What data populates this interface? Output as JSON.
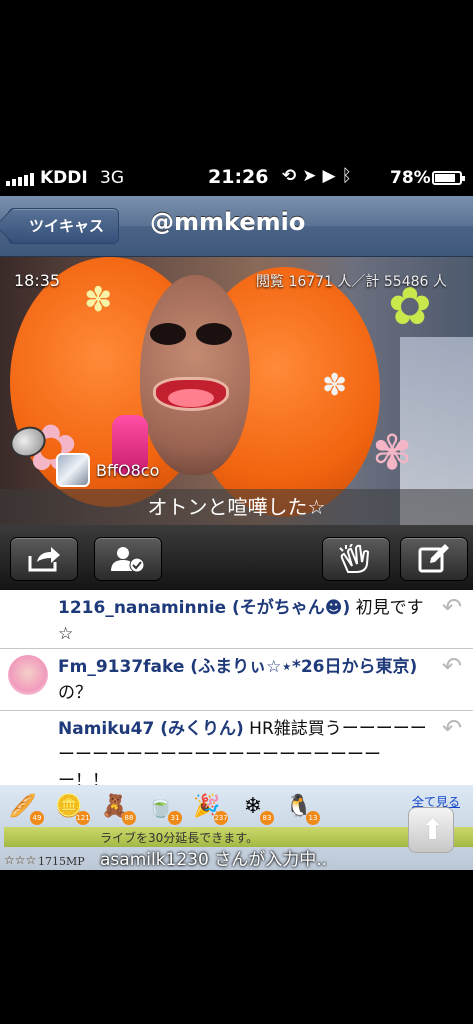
{
  "status_bar": {
    "carrier": "KDDI",
    "network": "3G",
    "time": "21:26",
    "battery": "78%",
    "battery_level": 0.78,
    "icons": [
      "rotation-lock-icon",
      "location-icon",
      "play-icon",
      "bluetooth-icon"
    ]
  },
  "navbar": {
    "back_label": "ツイキャス",
    "title": "@mmkemio"
  },
  "video": {
    "time": "18:35",
    "views": "閲覧 16771 人／計 55486 人",
    "commenter": "BffO8co",
    "overlay_comment": "オトンと喧嘩した☆"
  },
  "toolbar": {
    "buttons": [
      "share-icon",
      "follow-user-icon",
      "clap-icon",
      "compose-icon"
    ]
  },
  "comments": [
    {
      "user": "1216_nanaminnie (そがちゃん☻)",
      "text": " 初見です☆",
      "has_avatar": false
    },
    {
      "user": "Fm_9137fake (ふまりぃ☆⋆*26日から東京)",
      "text": " の？",
      "has_avatar": true
    },
    {
      "user": "Namiku47 (みくりん)",
      "text": " HR雑誌買うーーーーーーーーーーーーーーーーーーーーーーーーー！！",
      "has_avatar": false
    }
  ],
  "items_bar": {
    "items": [
      {
        "icon": "bread-icon",
        "count": "49"
      },
      {
        "icon": "coin-icon",
        "count": "121"
      },
      {
        "icon": "bear-icon",
        "count": "88"
      },
      {
        "icon": "tea-icon",
        "count": "31"
      },
      {
        "icon": "party-popper-icon",
        "count": "237"
      },
      {
        "icon": "snowflake-icon",
        "count": "83"
      },
      {
        "icon": "penguin-icon",
        "count": "13"
      }
    ],
    "show_all": "全て見る",
    "extend_text": "ライブを30分延長できます。",
    "typing": "asamilk1230 さんが入力中..",
    "mp_stars": "☆☆☆",
    "mp_value": "1715MP"
  },
  "colors": {
    "navbar": "#4a6386",
    "username": "#1f3a7a",
    "wig": "#f26410"
  }
}
